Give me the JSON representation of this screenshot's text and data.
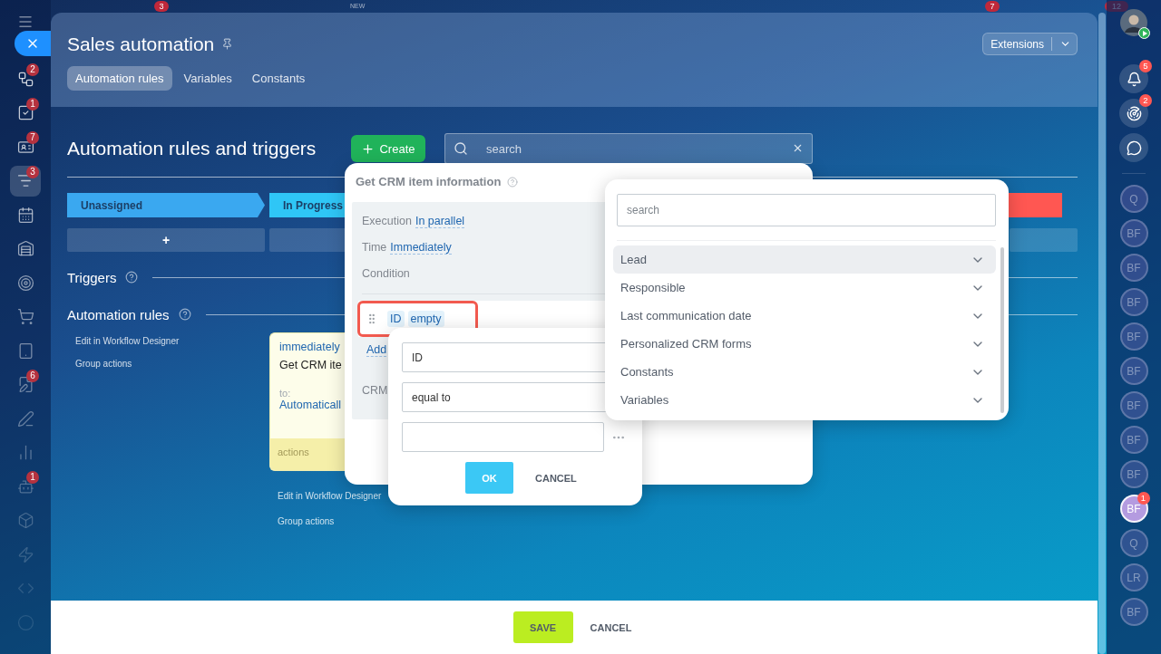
{
  "top_strip": {
    "items": [
      {
        "kind": "badge",
        "text": "3"
      },
      {
        "kind": "label",
        "text": "NEW"
      },
      {
        "kind": "badge",
        "text": "7"
      },
      {
        "kind": "badge",
        "text": "12"
      }
    ]
  },
  "left_sidebar": {
    "items": [
      {
        "badge": "2",
        "selected": false
      },
      {
        "badge": "1",
        "selected": false
      },
      {
        "badge": "7",
        "selected": false
      },
      {
        "badge": "3",
        "selected": true
      },
      {
        "selected": false
      },
      {
        "selected": false
      },
      {
        "selected": false
      },
      {
        "selected": false
      },
      {
        "selected": false
      },
      {
        "badge": "6",
        "selected": false
      },
      {
        "selected": false
      },
      {
        "selected": false
      },
      {
        "badge": "1",
        "selected": false
      },
      {
        "selected": false
      },
      {
        "selected": false
      },
      {
        "selected": false
      },
      {
        "selected": false
      }
    ]
  },
  "panel": {
    "title": "Sales automation",
    "extensions_button": "Extensions",
    "tabs": [
      {
        "label": "Automation rules",
        "selected": true
      },
      {
        "label": "Variables",
        "selected": false
      },
      {
        "label": "Constants",
        "selected": false
      }
    ]
  },
  "content": {
    "heading": "Automation rules and triggers",
    "create_button": "Create",
    "search": {
      "placeholder": "search"
    },
    "stages": [
      {
        "name": "Unassigned",
        "color": "#3aa8f0"
      },
      {
        "name": "In Progress",
        "color": "#2fc6f6"
      },
      {
        "color": "#ff5752"
      }
    ],
    "add_label": "+",
    "triggers_title": "Triggers",
    "rules_title": "Automation rules",
    "stage_links": [
      "Edit in Workflow Designer",
      "Group actions"
    ],
    "rule_card": {
      "timing": "immediately",
      "title": "Get CRM ite",
      "to_label": "to:",
      "target": "Automaticall",
      "footer": "actions"
    },
    "card_links": [
      "Edit in Workflow Designer",
      "Group actions"
    ]
  },
  "action_dialog": {
    "title": "Get CRM item information",
    "execution_label": "Execution",
    "execution_value": "In parallel",
    "time_label": "Time",
    "time_value": "Immediately",
    "condition_label": "Condition",
    "condition": {
      "field": "ID",
      "operator": "empty"
    },
    "add_link": "Add",
    "crm_label": "CRM"
  },
  "condition_editor": {
    "field": "ID",
    "operator": "equal to",
    "ok_button": "OK",
    "cancel_button": "CANCEL"
  },
  "field_picker": {
    "search": {
      "placeholder": "search"
    },
    "items": [
      {
        "label": "Lead",
        "selected": true
      },
      {
        "label": "Responsible",
        "selected": false
      },
      {
        "label": "Last communication date",
        "selected": false
      },
      {
        "label": "Personalized CRM forms",
        "selected": false
      },
      {
        "label": "Constants",
        "selected": false
      },
      {
        "label": "Variables",
        "selected": false
      }
    ]
  },
  "footer": {
    "save_button": "SAVE",
    "cancel_button": "CANCEL"
  },
  "right_sidebar": {
    "notification_badge": "5",
    "activity_badge": "2",
    "contacts": [
      {
        "initials": "Q",
        "selected": false
      },
      {
        "initials": "BF",
        "selected": false
      },
      {
        "initials": "BF",
        "selected": false
      },
      {
        "initials": "BF",
        "selected": false
      },
      {
        "initials": "BF",
        "selected": false
      },
      {
        "initials": "BF",
        "selected": false
      },
      {
        "initials": "BF",
        "selected": false
      },
      {
        "initials": "BF",
        "selected": false
      },
      {
        "initials": "BF",
        "selected": false
      },
      {
        "initials": "BF",
        "selected": true,
        "badge": "1"
      },
      {
        "initials": "Q",
        "selected": false
      },
      {
        "initials": "LR",
        "selected": false
      },
      {
        "initials": "BF",
        "selected": false
      }
    ]
  }
}
